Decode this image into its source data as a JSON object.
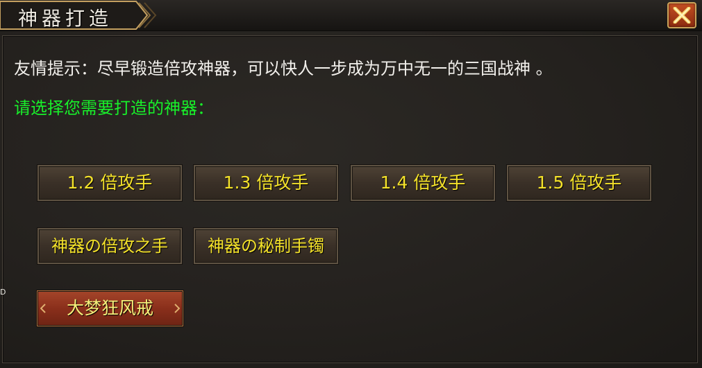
{
  "window": {
    "title": "神器打造",
    "close_icon": "close-x-icon"
  },
  "content": {
    "tip": "友情提示：尽早锻造倍攻神器，可以快人一步成为万中无一的三国战神 。",
    "prompt": "请选择您需要打造的神器："
  },
  "options": {
    "row1": [
      "1.2 倍攻手",
      "1.3 倍攻手",
      "1.4 倍攻手",
      "1.5 倍攻手"
    ],
    "row2": [
      "神器の倍攻之手",
      "神器の秘制手镯"
    ],
    "special": "大梦狂风戒"
  },
  "edge_text": "D",
  "colors": {
    "tip_text": "#f2f0ec",
    "prompt_text": "#18f02a",
    "button_text": "#f4e22a",
    "special_button": "#8a2f1b",
    "close_button": "#b33f1a"
  }
}
